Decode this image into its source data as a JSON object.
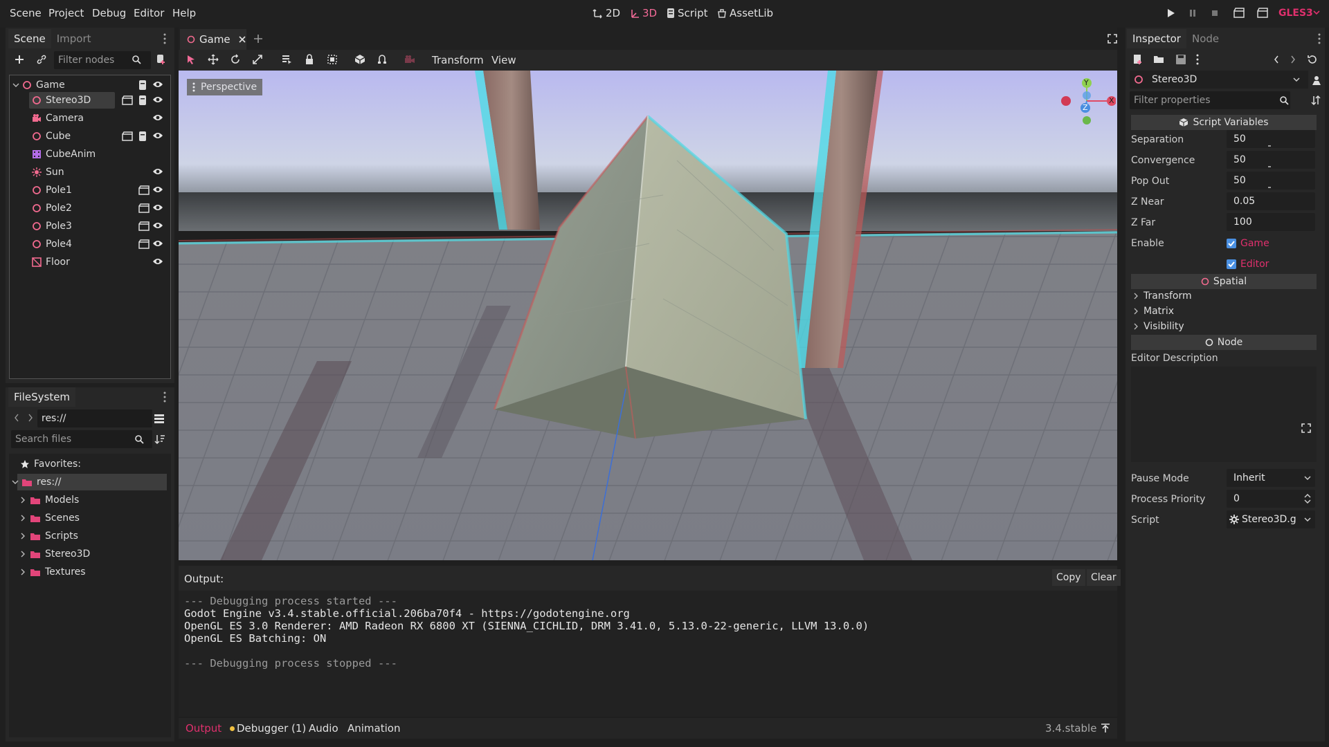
{
  "menubar": {
    "scene": "Scene",
    "project": "Project",
    "debug": "Debug",
    "editor": "Editor",
    "help": "Help",
    "ws_2d": "2D",
    "ws_3d": "3D",
    "ws_script": "Script",
    "ws_assetlib": "AssetLib",
    "renderer": "GLES3"
  },
  "scene_dock": {
    "tab_scene": "Scene",
    "tab_import": "Import",
    "filter_placeholder": "Filter nodes",
    "nodes": [
      "Game",
      "Stereo3D",
      "Camera",
      "Cube",
      "CubeAnim",
      "Sun",
      "Pole1",
      "Pole2",
      "Pole3",
      "Pole4",
      "Floor"
    ]
  },
  "filesystem": {
    "title": "FileSystem",
    "path": "res://",
    "search_placeholder": "Search files",
    "favorites": "Favorites:",
    "root": "res://",
    "folders": [
      "Models",
      "Scenes",
      "Scripts",
      "Stereo3D",
      "Textures"
    ]
  },
  "center": {
    "tab_game": "Game",
    "menu_transform": "Transform",
    "menu_view": "View",
    "perspective": "Perspective",
    "gizmo": {
      "y": "Y",
      "x": "X",
      "z": "Z"
    }
  },
  "output": {
    "title": "Output:",
    "copy": "Copy",
    "clear": "Clear",
    "lines": [
      "--- Debugging process started ---",
      "Godot Engine v3.4.stable.official.206ba70f4 - https://godotengine.org",
      "OpenGL ES 3.0 Renderer: AMD Radeon RX 6800 XT (SIENNA_CICHLID, DRM 3.41.0, 5.13.0-22-generic, LLVM 13.0.0)",
      "OpenGL ES Batching: ON",
      "",
      "--- Debugging process stopped ---"
    ],
    "tabs": {
      "output": "Output",
      "debugger": "Debugger (1)",
      "audio": "Audio",
      "animation": "Animation"
    },
    "version": "3.4.stable"
  },
  "inspector": {
    "tab_inspector": "Inspector",
    "tab_node": "Node",
    "object": "Stereo3D",
    "filter_placeholder": "Filter properties",
    "section_script": "Script Variables",
    "props": [
      {
        "label": "Separation",
        "value": "50"
      },
      {
        "label": "Convergence",
        "value": "50"
      },
      {
        "label": "Pop Out",
        "value": "50"
      },
      {
        "label": "Z Near",
        "value": "0.05"
      },
      {
        "label": "Z Far",
        "value": "100"
      }
    ],
    "enable_label": "Enable",
    "enable_game": "Game",
    "enable_editor": "Editor",
    "section_spatial": "Spatial",
    "spatial_subs": [
      "Transform",
      "Matrix",
      "Visibility"
    ],
    "section_node": "Node",
    "editor_description": "Editor Description",
    "pause_mode_label": "Pause Mode",
    "pause_mode_value": "Inherit",
    "process_priority_label": "Process Priority",
    "process_priority_value": "0",
    "script_label": "Script",
    "script_value": "Stereo3D.g"
  },
  "colors": {
    "accent": "#e0306d",
    "selection": "#3d3d3d",
    "folder": "#e2457a"
  }
}
